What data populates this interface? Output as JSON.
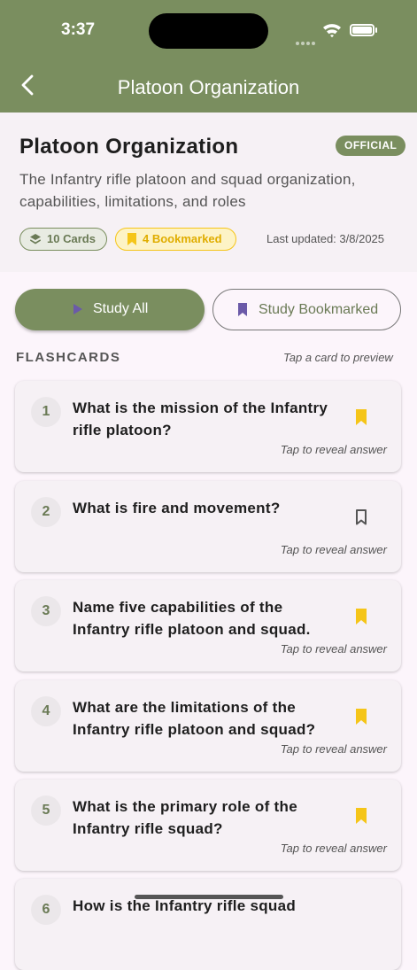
{
  "status": {
    "time": "3:37"
  },
  "appbar": {
    "title": "Platoon Organization"
  },
  "header": {
    "title": "Platoon Organization",
    "badge": "OFFICIAL",
    "description": "The Infantry rifle platoon and squad organization, capabilities, limitations, and roles",
    "cards_chip": "10 Cards",
    "bookmarked_chip": "4 Bookmarked",
    "updated": "Last updated: 3/8/2025"
  },
  "actions": {
    "study_all": "Study All",
    "study_bookmarked": "Study Bookmarked"
  },
  "section": {
    "label": "FLASHCARDS",
    "hint": "Tap a card to preview"
  },
  "cards": [
    {
      "num": "1",
      "question": "What is the mission of the Infantry rifle platoon?",
      "hint": "Tap to reveal answer",
      "bookmarked": true
    },
    {
      "num": "2",
      "question": "What is fire and movement?",
      "hint": "Tap to reveal answer",
      "bookmarked": false
    },
    {
      "num": "3",
      "question": "Name five capabilities of the Infantry rifle platoon and squad.",
      "hint": "Tap to reveal answer",
      "bookmarked": true
    },
    {
      "num": "4",
      "question": "What are the limitations of the Infantry rifle platoon and squad?",
      "hint": "Tap to reveal answer",
      "bookmarked": true
    },
    {
      "num": "5",
      "question": "What is the primary role of the Infantry rifle squad?",
      "hint": "Tap to reveal answer",
      "bookmarked": true
    },
    {
      "num": "6",
      "question": "How is the Infantry rifle squad",
      "hint": "",
      "bookmarked": false
    }
  ],
  "colors": {
    "primary": "#7a8e5f",
    "bookmark": "#f5c518",
    "accent_purple": "#6b5aa8"
  }
}
